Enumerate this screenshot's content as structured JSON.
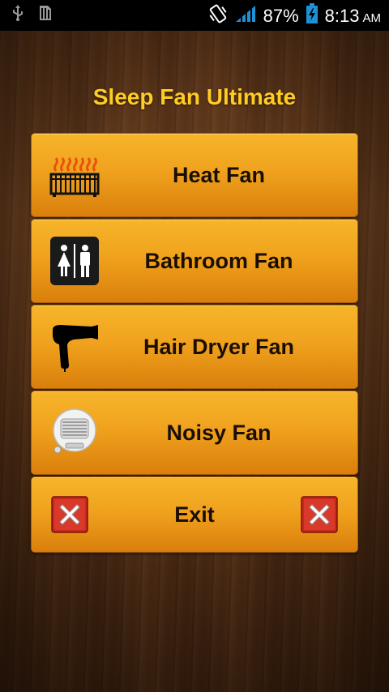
{
  "status_bar": {
    "battery_percent": "87%",
    "time": "8:13",
    "ampm": "AM",
    "icons": [
      "usb-icon",
      "sim-card-icon",
      "vibrate-icon",
      "signal-icon",
      "battery-charging-icon"
    ]
  },
  "app": {
    "title": "Sleep Fan Ultimate"
  },
  "menu": {
    "items": [
      {
        "label": "Heat Fan",
        "icon": "heater-icon"
      },
      {
        "label": "Bathroom Fan",
        "icon": "restroom-icon"
      },
      {
        "label": "Hair Dryer Fan",
        "icon": "hair-dryer-icon"
      },
      {
        "label": "Noisy Fan",
        "icon": "space-heater-fan-icon"
      }
    ],
    "exit_label": "Exit"
  },
  "colors": {
    "title": "#ffcc22",
    "button_top": "#f6b52a",
    "button_bottom": "#d97f0c",
    "label": "#1a0e02",
    "exit_icon_red": "#d42a1e"
  }
}
